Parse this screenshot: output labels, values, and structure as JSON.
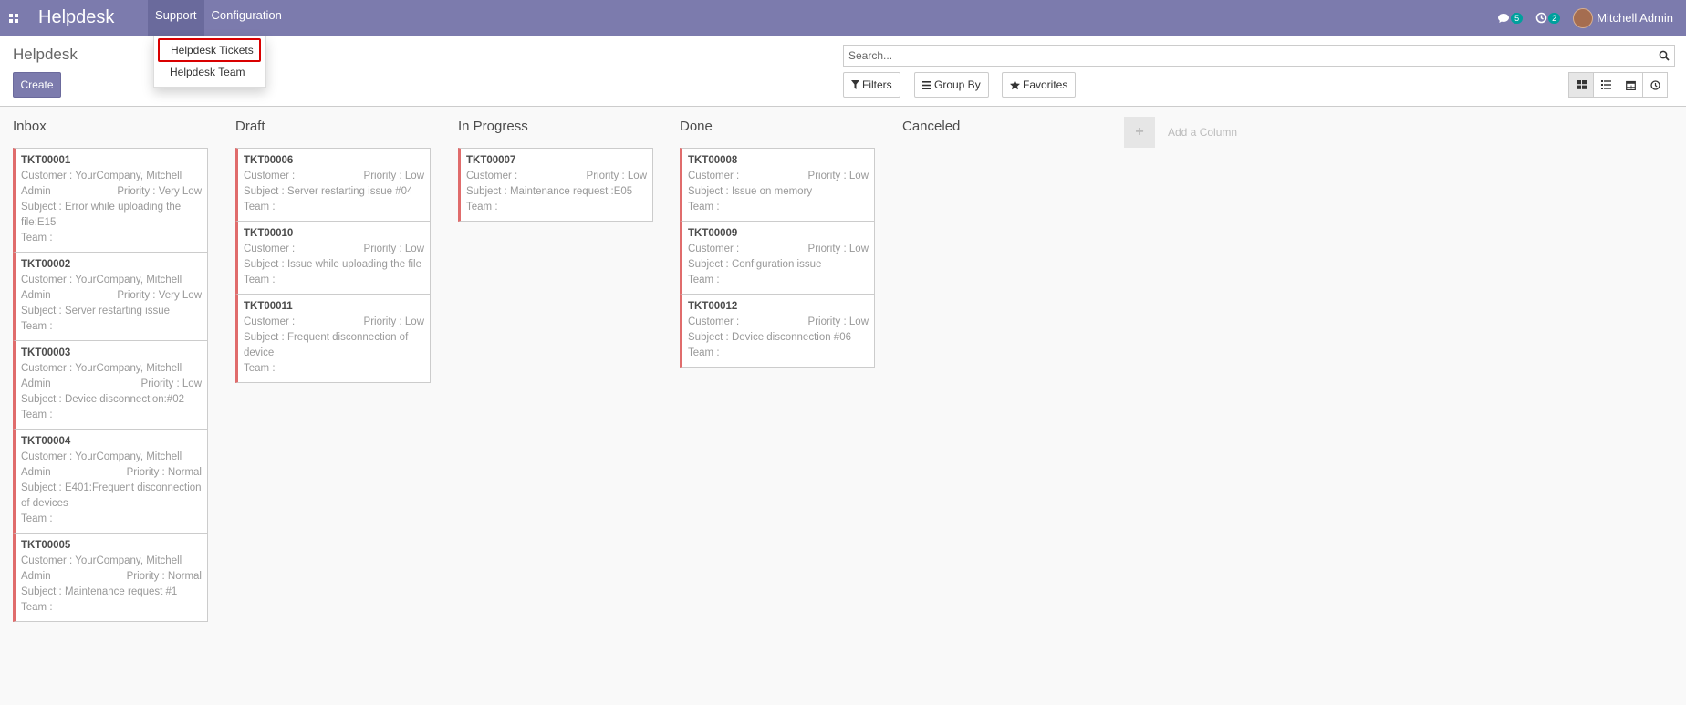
{
  "navbar": {
    "brand": "Helpdesk",
    "menus": [
      "Support",
      "Configuration"
    ],
    "chat_count": "5",
    "activity_count": "2",
    "user_name": "Mitchell Admin"
  },
  "dropdown": {
    "items": [
      "Helpdesk Tickets",
      "Helpdesk Team"
    ]
  },
  "control": {
    "breadcrumb": "Helpdesk",
    "create_label": "Create",
    "search_placeholder": "Search...",
    "filters_label": "Filters",
    "groupby_label": "Group By",
    "favorites_label": "Favorites"
  },
  "kanban": {
    "add_column_label": "Add a Column",
    "columns": [
      {
        "title": "Inbox",
        "cards": [
          {
            "ref": "TKT00001",
            "customer": "Customer : YourCompany, Mitchell",
            "customer2": "Admin",
            "priority": "Priority : Very Low",
            "subject": "Subject : Error while uploading the file:E15",
            "team": "Team :"
          },
          {
            "ref": "TKT00002",
            "customer": "Customer : YourCompany, Mitchell",
            "customer2": "Admin",
            "priority": "Priority : Very Low",
            "subject": "Subject : Server restarting issue",
            "team": "Team :"
          },
          {
            "ref": "TKT00003",
            "customer": "Customer : YourCompany, Mitchell",
            "customer2": "Admin",
            "priority": "Priority : Low",
            "subject": "Subject : Device disconnection:#02",
            "team": "Team :"
          },
          {
            "ref": "TKT00004",
            "customer": "Customer : YourCompany, Mitchell",
            "customer2": "Admin",
            "priority": "Priority : Normal",
            "subject": "Subject : E401:Frequent disconnection of devices",
            "team": "Team :"
          },
          {
            "ref": "TKT00005",
            "customer": "Customer : YourCompany, Mitchell",
            "customer2": "Admin",
            "priority": "Priority : Normal",
            "subject": "Subject : Maintenance request #1",
            "team": "Team :"
          }
        ]
      },
      {
        "title": "Draft",
        "cards": [
          {
            "ref": "TKT00006",
            "customer": "Customer :",
            "customer2": "",
            "priority": "Priority : Low",
            "subject": "Subject : Server restarting issue #04",
            "team": "Team :"
          },
          {
            "ref": "TKT00010",
            "customer": "Customer :",
            "customer2": "",
            "priority": "Priority : Low",
            "subject": "Subject : Issue while uploading the file",
            "team": "Team :"
          },
          {
            "ref": "TKT00011",
            "customer": "Customer :",
            "customer2": "",
            "priority": "Priority : Low",
            "subject": "Subject : Frequent disconnection of device",
            "team": "Team :"
          }
        ]
      },
      {
        "title": "In Progress",
        "cards": [
          {
            "ref": "TKT00007",
            "customer": "Customer :",
            "customer2": "",
            "priority": "Priority : Low",
            "subject": "Subject : Maintenance request :E05",
            "team": "Team :"
          }
        ]
      },
      {
        "title": "Done",
        "cards": [
          {
            "ref": "TKT00008",
            "customer": "Customer :",
            "customer2": "",
            "priority": "Priority : Low",
            "subject": "Subject : Issue on memory",
            "team": "Team :"
          },
          {
            "ref": "TKT00009",
            "customer": "Customer :",
            "customer2": "",
            "priority": "Priority : Low",
            "subject": "Subject : Configuration issue",
            "team": "Team :"
          },
          {
            "ref": "TKT00012",
            "customer": "Customer :",
            "customer2": "",
            "priority": "Priority : Low",
            "subject": "Subject : Device disconnection #06",
            "team": "Team :"
          }
        ]
      },
      {
        "title": "Canceled",
        "cards": []
      }
    ]
  },
  "colors": {
    "navbar": "#7c7bad",
    "card_accent": "#e06c6c",
    "badge": "#00a09d",
    "highlight_border": "#d90000"
  }
}
